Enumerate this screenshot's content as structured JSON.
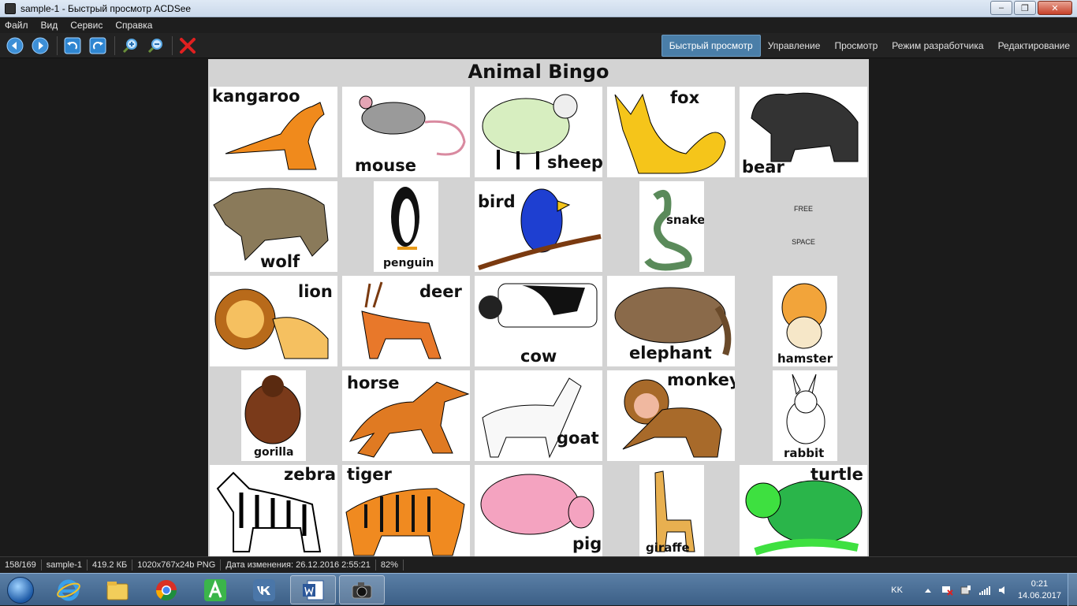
{
  "window": {
    "title": "sample-1 - Быстрый просмотр ACDSee"
  },
  "menu": {
    "items": [
      "Файл",
      "Вид",
      "Сервис",
      "Справка"
    ]
  },
  "modes": {
    "items": [
      "Быстрый просмотр",
      "Управление",
      "Просмотр",
      "Режим разработчика",
      "Редактирование"
    ]
  },
  "document": {
    "title": "Animal Bingo",
    "free_line1": "FREE",
    "free_line2": "SPACE",
    "cells": [
      "kangaroo",
      "mouse",
      "sheep",
      "fox",
      "bear",
      "wolf",
      "penguin",
      "bird",
      "snake",
      "lion",
      "deer",
      "cow",
      "elephant",
      "hamster",
      "gorilla",
      "horse",
      "goat",
      "monkey",
      "rabbit",
      "zebra",
      "tiger",
      "pig",
      "giraffe",
      "turtle"
    ]
  },
  "status": {
    "index": "158/169",
    "name": "sample-1",
    "size": "419.2 КБ",
    "dims": "1020x767x24b PNG",
    "modified": "Дата изменения: 26.12.2016 2:55:21",
    "zoom": "82%"
  },
  "taskbar": {
    "lang": "KK",
    "time": "0:21",
    "date": "14.06.2017"
  },
  "colors": {
    "accent": "#4a7ea8",
    "toolbar_bg": "#232323"
  }
}
